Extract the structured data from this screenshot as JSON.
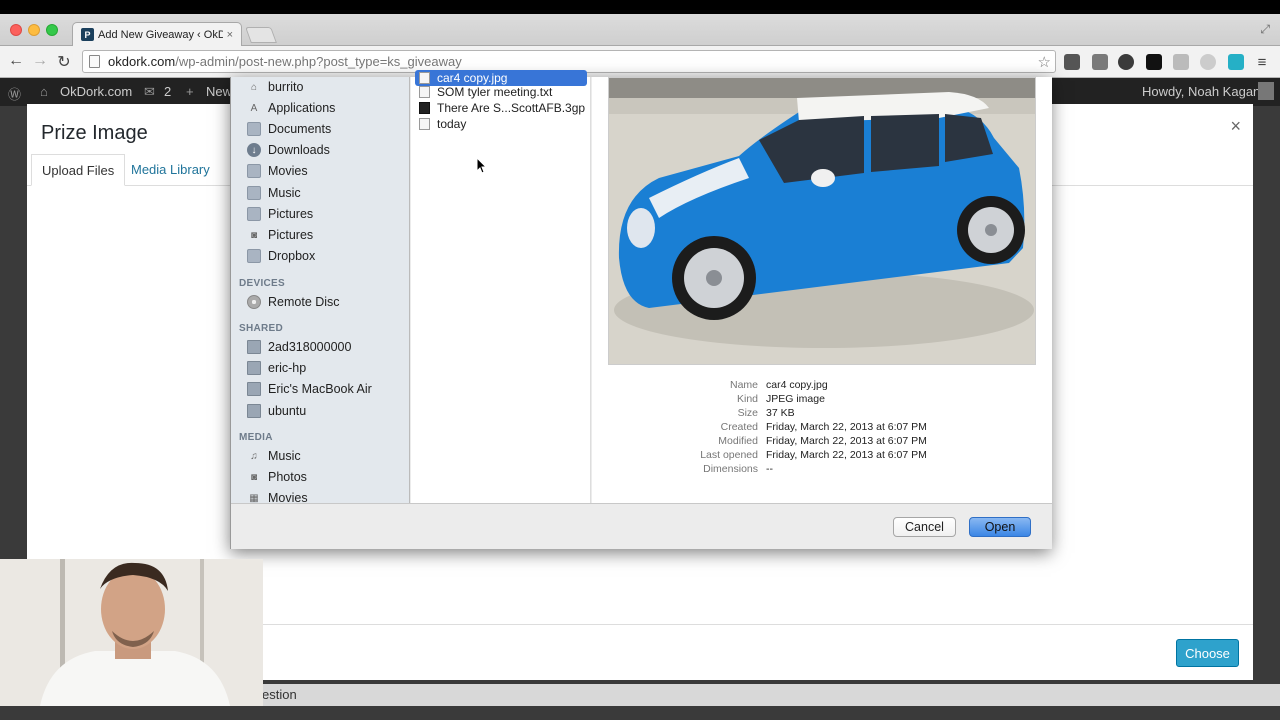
{
  "browser": {
    "tab_title": "Add New Giveaway ‹ OkDo",
    "tab_favicon": "P",
    "tab_close": "×",
    "url_host": "okdork.com",
    "url_path": "/wp-admin/post-new.php?post_type=ks_giveaway",
    "back": "←",
    "forward": "→",
    "reload": "↻",
    "star": "☆",
    "fullscreen": "⤢"
  },
  "adminbar": {
    "wp_logo": "Ⓦ",
    "home_icon": "⌂",
    "site": "OkDork.com",
    "comments_icon": "✉",
    "comments": "2",
    "new_icon": "+",
    "new": "New",
    "howdy": "Howdy, Noah Kagan"
  },
  "modal": {
    "title": "Prize Image",
    "close": "×",
    "tab_upload": "Upload Files",
    "tab_library": "Media Library",
    "choose": "Choose"
  },
  "bottom_strip": {
    "text": "estion"
  },
  "dialog": {
    "favorites": [
      {
        "label": "burrito",
        "icon": "home-icon",
        "glyph": "⌂"
      },
      {
        "label": "Applications",
        "icon": "applications-icon",
        "glyph": "A"
      },
      {
        "label": "Documents",
        "icon": "folder-icon",
        "glyph": ""
      },
      {
        "label": "Downloads",
        "icon": "download-icon",
        "glyph": "↓"
      },
      {
        "label": "Movies",
        "icon": "folder-icon",
        "glyph": ""
      },
      {
        "label": "Music",
        "icon": "folder-icon",
        "glyph": ""
      },
      {
        "label": "Pictures",
        "icon": "folder-icon",
        "glyph": ""
      },
      {
        "label": "Pictures",
        "icon": "camera-icon",
        "glyph": "◙"
      },
      {
        "label": "Dropbox",
        "icon": "folder-icon",
        "glyph": ""
      }
    ],
    "devices_head": "DEVICES",
    "devices": [
      {
        "label": "Remote Disc"
      }
    ],
    "shared_head": "SHARED",
    "shared": [
      {
        "label": "2ad318000000"
      },
      {
        "label": "eric-hp"
      },
      {
        "label": "Eric's MacBook Air"
      },
      {
        "label": "ubuntu"
      }
    ],
    "media_head": "MEDIA",
    "media": [
      {
        "label": "Music",
        "glyph": "♫"
      },
      {
        "label": "Photos",
        "glyph": "◙"
      },
      {
        "label": "Movies",
        "glyph": "▦"
      }
    ],
    "files": [
      {
        "name": "car4 copy.jpg",
        "selected": true
      },
      {
        "name": "SOM tyler meeting.txt",
        "selected": false
      },
      {
        "name": "There Are S...ScottAFB.3gp",
        "selected": false
      },
      {
        "name": "today",
        "selected": false
      }
    ],
    "info": {
      "name_label": "Name",
      "name": "car4 copy.jpg",
      "kind_label": "Kind",
      "kind": "JPEG image",
      "size_label": "Size",
      "size": "37 KB",
      "created_label": "Created",
      "created": "Friday, March 22, 2013 at 6:07 PM",
      "modified_label": "Modified",
      "modified": "Friday, March 22, 2013 at 6:07 PM",
      "opened_label": "Last opened",
      "opened": "Friday, March 22, 2013 at 6:07 PM",
      "dims_label": "Dimensions",
      "dims": "--"
    },
    "cancel": "Cancel",
    "open": "Open"
  },
  "colors": {
    "accent": "#2ea2cc",
    "selection": "#3875d7",
    "car_blue": "#1a7fd4"
  }
}
